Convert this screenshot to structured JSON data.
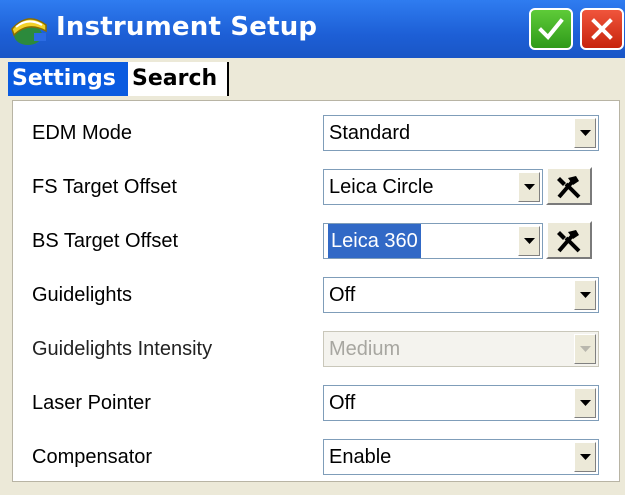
{
  "window": {
    "title": "Instrument Setup",
    "icons": {
      "app": "survey-helmet-icon",
      "ok": "checkmark-icon",
      "close": "close-icon"
    },
    "colors": {
      "titlebar": "#1d5fd6",
      "ok": "#3aa523",
      "close": "#d9301a",
      "tab_active": "#0a5be0"
    }
  },
  "tabs": [
    {
      "label": "Settings",
      "active": true
    },
    {
      "label": "Search",
      "active": false
    }
  ],
  "settings": {
    "edm_mode": {
      "label": "EDM Mode",
      "value": "Standard"
    },
    "fs_target_offset": {
      "label": "FS Target Offset",
      "value": "Leica Circle"
    },
    "bs_target_offset": {
      "label": "BS Target Offset",
      "value": "Leica 360"
    },
    "guidelights": {
      "label": "Guidelights",
      "value": "Off"
    },
    "guidelights_intensity": {
      "label": "Guidelights Intensity",
      "value": "Medium",
      "disabled": true
    },
    "laser_pointer": {
      "label": "Laser Pointer",
      "value": "Off"
    },
    "compensator": {
      "label": "Compensator",
      "value": "Enable"
    }
  }
}
